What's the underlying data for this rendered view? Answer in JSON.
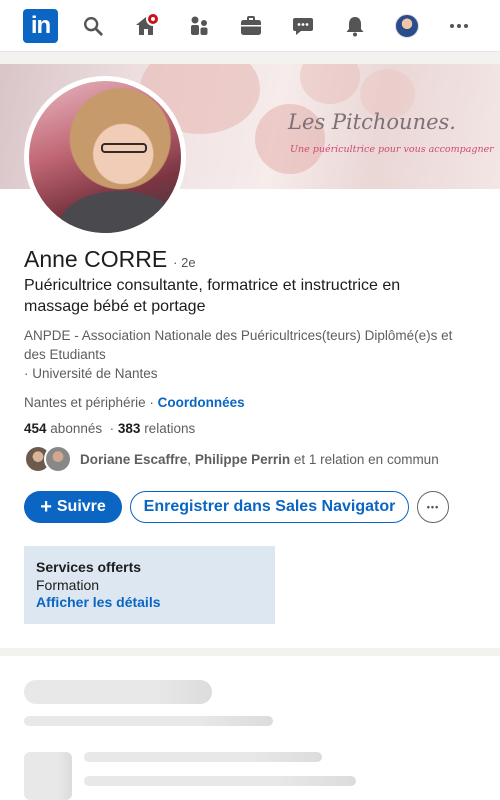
{
  "nav": {
    "logo_text": "in",
    "items": [
      "home",
      "search",
      "my-network",
      "jobs",
      "messaging",
      "notifications",
      "me",
      "more"
    ]
  },
  "banner": {
    "title": "Les Pitchounes.",
    "subtitle": "Une puéricultrice pour vous accompagner"
  },
  "profile": {
    "name": "Anne CORRE",
    "degree": "· 2e",
    "headline": "Puéricultrice consultante, formatrice et instructrice en massage bébé et portage",
    "organization": "ANPDE - Association Nationale des Puéricultrices(teurs) Diplômé(e)s et des Etudiants",
    "school": "· Université de Nantes",
    "location": "Nantes et périphérie ·",
    "contact_link": "Coordonnées",
    "followers_count": "454",
    "followers_label": "abonnés",
    "connections_prefix": "·",
    "connections_count": "383",
    "connections_label": "relations",
    "mutual": {
      "name1": "Doriane Escaffre",
      "sep": ",",
      "name2": "Philippe Perrin",
      "suffix": "et 1 relation en commun"
    }
  },
  "actions": {
    "follow_icon": "+",
    "follow_label": "Suivre",
    "sales_nav_label": "Enregistrer dans Sales Navigator",
    "more_label": "•••"
  },
  "services": {
    "title": "Services offerts",
    "value": "Formation",
    "details_link": "Afficher les détails"
  },
  "colors": {
    "brand": "#0a66c2",
    "notification": "#cc1016",
    "services_bg": "#dde7f1"
  }
}
